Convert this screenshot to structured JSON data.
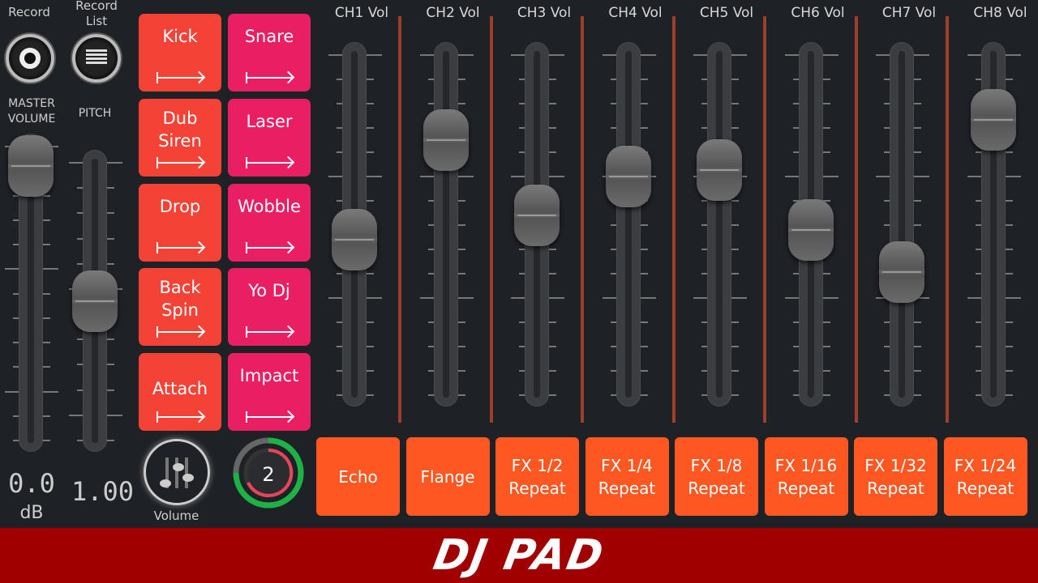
{
  "record": {
    "label": "Record",
    "icon": "record-icon"
  },
  "record_list": {
    "label": "Record\nList",
    "icon": "list-icon"
  },
  "master": {
    "label": "MASTER\nVOLUME",
    "level": 1.0,
    "value": "0.0",
    "unit": "dB"
  },
  "pitch": {
    "label": "PITCH",
    "level": 0.5,
    "value": "1.00"
  },
  "pads": [
    {
      "label": "Kick",
      "color": "#f44336"
    },
    {
      "label": "Snare",
      "color": "#e91e63"
    },
    {
      "label": "Dub\nSiren",
      "color": "#f44336"
    },
    {
      "label": "Laser",
      "color": "#e91e63"
    },
    {
      "label": "Drop",
      "color": "#f44336"
    },
    {
      "label": "Wobble",
      "color": "#e91e63"
    },
    {
      "label": "Back\nSpin",
      "color": "#f44336"
    },
    {
      "label": "Yo Dj",
      "color": "#e91e63"
    },
    {
      "label": "Attach",
      "color": "#f44336"
    },
    {
      "label": "Impact",
      "color": "#e91e63"
    }
  ],
  "volume_button": {
    "label": "Volume",
    "icon": "sliders-icon"
  },
  "counter": {
    "value": "2",
    "ring_color": "#1db245",
    "inner_color": "#e8445a"
  },
  "channels": [
    {
      "label": "CH1 Vol",
      "level": 0.45
    },
    {
      "label": "CH2 Vol",
      "level": 0.78
    },
    {
      "label": "CH3 Vol",
      "level": 0.53
    },
    {
      "label": "CH4 Vol",
      "level": 0.66
    },
    {
      "label": "CH5 Vol",
      "level": 0.68
    },
    {
      "label": "CH6 Vol",
      "level": 0.48
    },
    {
      "label": "CH7 Vol",
      "level": 0.34
    },
    {
      "label": "CH8 Vol",
      "level": 0.85
    }
  ],
  "fx": [
    "Echo",
    "Flange",
    "FX 1/2\nRepeat",
    "FX 1/4\nRepeat",
    "FX 1/8\nRepeat",
    "FX 1/16\nRepeat",
    "FX 1/32\nRepeat",
    "FX 1/24\nRepeat"
  ],
  "fx_color": "#ff5722",
  "brand": {
    "logo": "DJ PAD",
    "bar_color": "#a00000"
  }
}
